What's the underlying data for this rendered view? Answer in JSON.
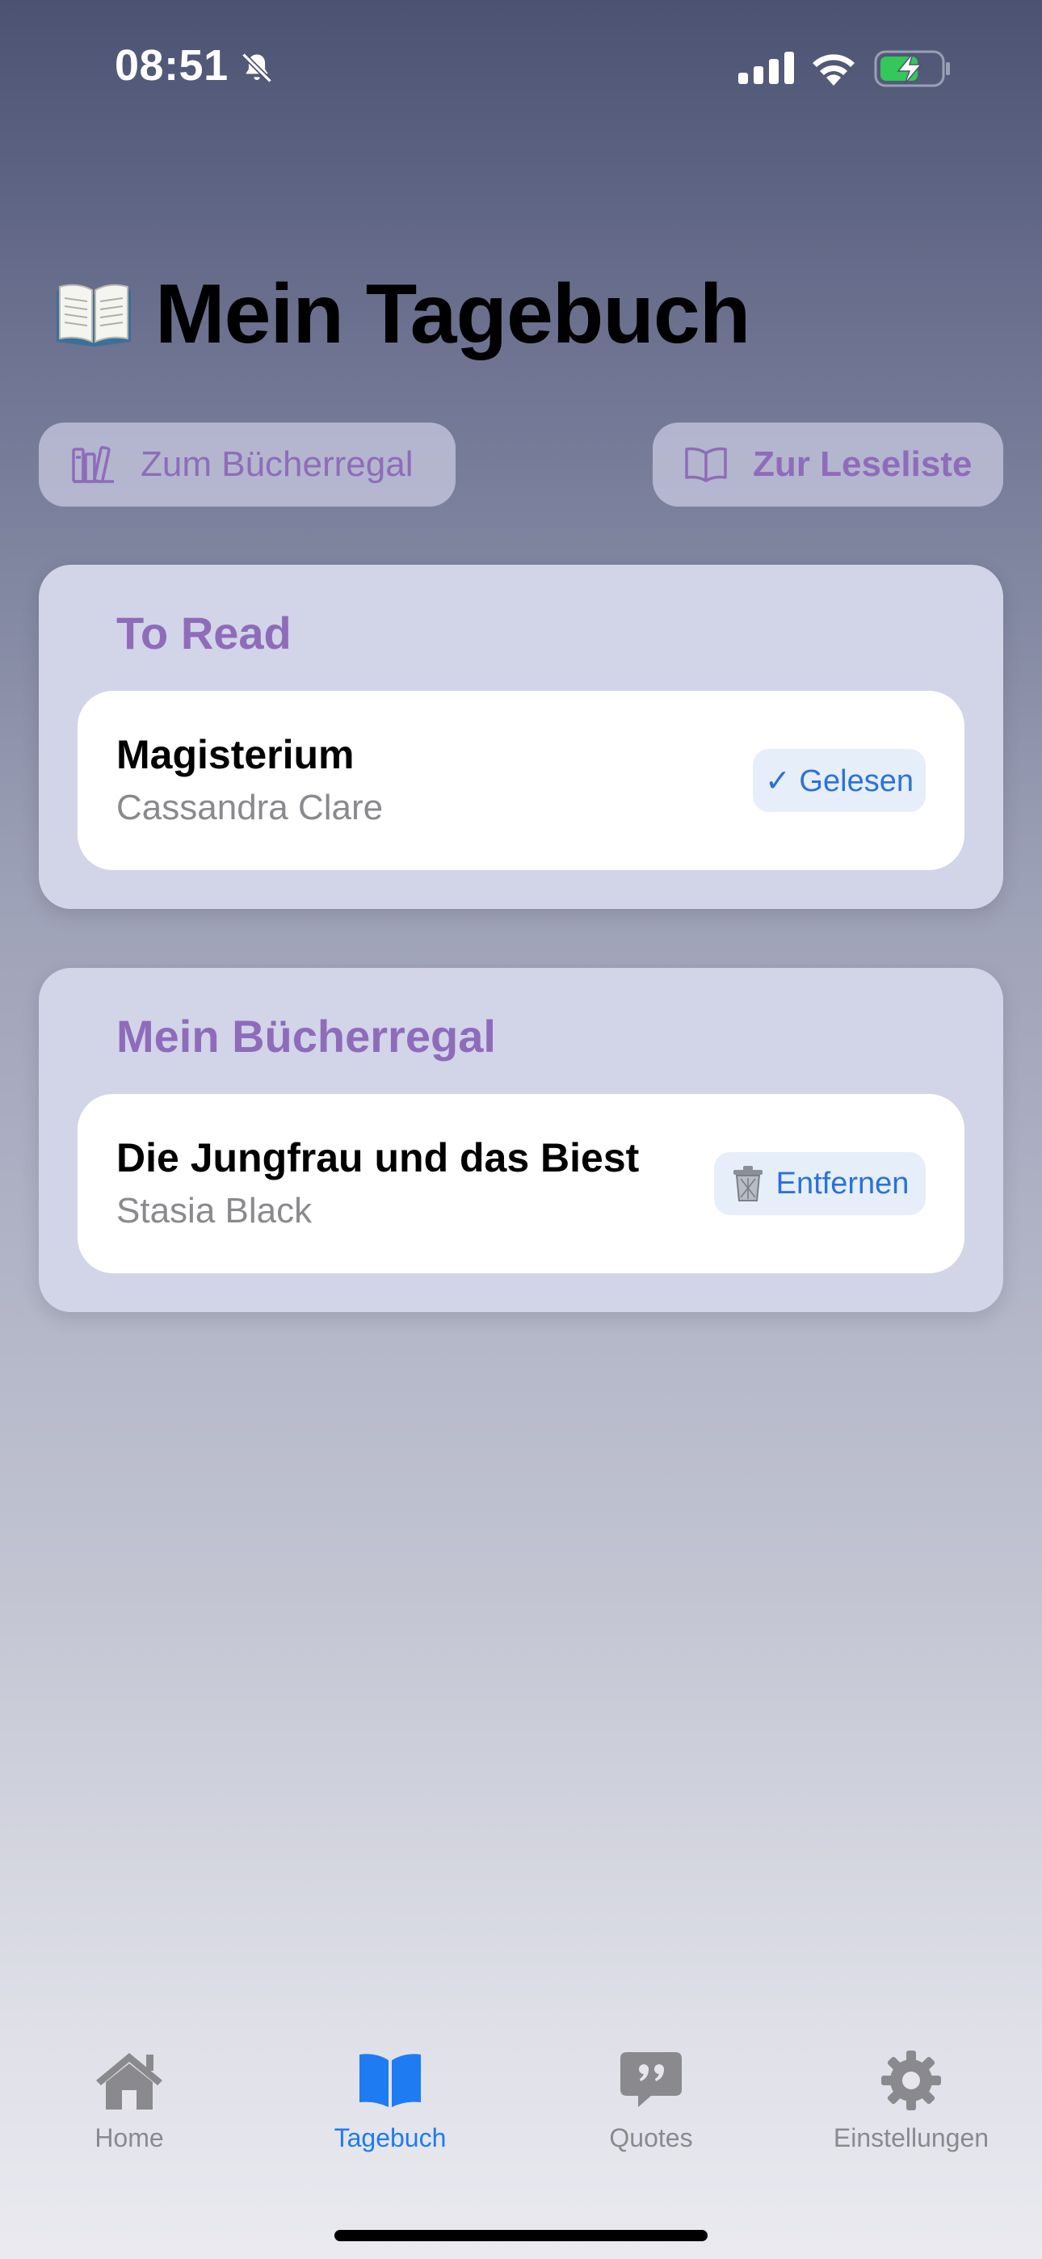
{
  "status_bar": {
    "time": "08:51",
    "icons": [
      "bell-off-icon",
      "cellular-signal-icon",
      "wifi-icon",
      "battery-charging-icon"
    ]
  },
  "header": {
    "title": "Mein Tagebuch",
    "emoji_icon": "open-book-icon"
  },
  "nav_buttons": {
    "bookshelf_label": "Zum Bücherregal",
    "reading_list_label": "Zur Leseliste"
  },
  "sections": {
    "to_read": {
      "title": "To Read",
      "books": [
        {
          "title": "Magisterium",
          "author": "Cassandra Clare",
          "action_label": "✓ Gelesen"
        }
      ]
    },
    "bookshelf": {
      "title": "Mein Bücherregal",
      "books": [
        {
          "title": "Die Jungfrau und das Biest",
          "author": "Stasia Black",
          "action_label": "Entfernen",
          "action_icon": "trash-can-icon"
        }
      ]
    }
  },
  "tab_bar": {
    "tabs": [
      {
        "label": "Home",
        "icon": "house-icon",
        "active": false
      },
      {
        "label": "Tagebuch",
        "icon": "book-icon",
        "active": true
      },
      {
        "label": "Quotes",
        "icon": "quote-bubble-icon",
        "active": false
      },
      {
        "label": "Einstellungen",
        "icon": "gear-icon",
        "active": false
      }
    ]
  },
  "colors": {
    "accent_purple": "#8e6cba",
    "active_blue": "#1f7bf2",
    "action_blue": "#2b72d8",
    "inactive_gray": "#8a8a8e"
  }
}
